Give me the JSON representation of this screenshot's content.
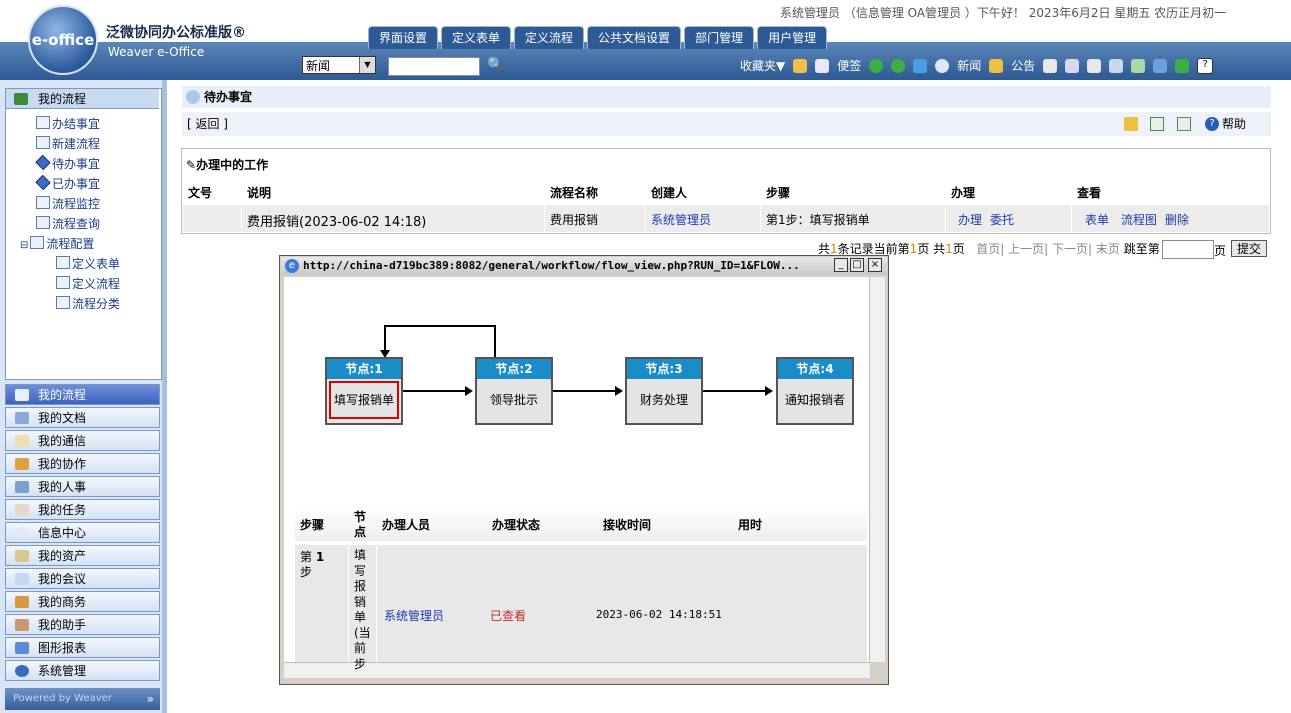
{
  "header": {
    "logo_text": "e-office",
    "brand_cn": "泛微协同办公标准版®",
    "brand_en": "Weaver e-Office",
    "greeting": "系统管理员 （信息管理 OA管理员 ）下午好！ 2023年6月2日 星期五 农历正月初一",
    "tabs": [
      "界面设置",
      "定义表单",
      "定义流程",
      "公共文档设置",
      "部门管理",
      "用户管理"
    ],
    "news_select": "新闻",
    "tools": [
      "收藏夹▼",
      "便签",
      "新闻",
      "公告"
    ]
  },
  "sidebar": {
    "tree_title": "我的流程",
    "tree_items": [
      "办结事宜",
      "新建流程",
      "待办事宜",
      "已办事宜",
      "流程监控",
      "流程查询",
      "流程配置",
      "定义表单",
      "定义流程",
      "流程分类"
    ],
    "nav": [
      "我的流程",
      "我的文档",
      "我的通信",
      "我的协作",
      "我的人事",
      "我的任务",
      "信息中心",
      "我的资产",
      "我的会议",
      "我的商务",
      "我的助手",
      "图形报表",
      "系统管理"
    ],
    "powered": "Powered by Weaver"
  },
  "main": {
    "title": "待办事宜",
    "back": "[ 返回 ]",
    "help": "帮助",
    "section": "办理中的工作",
    "columns": [
      "文号",
      "说明",
      "流程名称",
      "创建人",
      "步骤",
      "办理",
      "查看"
    ],
    "row": {
      "num": "",
      "desc": "费用报销(2023-06-02 14:18)",
      "flow": "费用报销",
      "creator": "系统管理员",
      "step": "第1步：填写报销单",
      "handle": "办理",
      "entrust": "委托",
      "form": "表单",
      "chart": "流程图",
      "del": "删除"
    },
    "pager": {
      "summary_a": "共",
      "count": "1",
      "summary_b": "条记录当前第",
      "page": "1",
      "summary_c": "页 共",
      "total": "1",
      "summary_d": "页",
      "first": "首页",
      "prev": "上一页",
      "next": "下一页",
      "last": "末页",
      "jump": "跳至第",
      "page_unit": "页",
      "submit": "提交"
    }
  },
  "popup": {
    "title": "http://china-d719bc389:8082/general/workflow/flow_view.php?RUN_ID=1&FLOW...",
    "nodes": [
      {
        "header": "节点:1",
        "label": "填写报销单"
      },
      {
        "header": "节点:2",
        "label": "领导批示"
      },
      {
        "header": "节点:3",
        "label": "财务处理"
      },
      {
        "header": "节点:4",
        "label": "通知报销者"
      }
    ],
    "table_headers": [
      "步骤",
      "节点",
      "办理人员",
      "办理状态",
      "接收时间",
      "用时"
    ],
    "row": {
      "step_a": "第",
      "step_num": "1",
      "step_b": "步",
      "node_text": "填写报销单(当前步",
      "person": "系统管理员",
      "status": "已查看",
      "time": "2023-06-02 14:18:51"
    }
  },
  "colors": {
    "header_band": "#2d5a94",
    "node_header": "#1a8cc8",
    "link": "#1a3aa8",
    "status_red": "#c03030"
  }
}
